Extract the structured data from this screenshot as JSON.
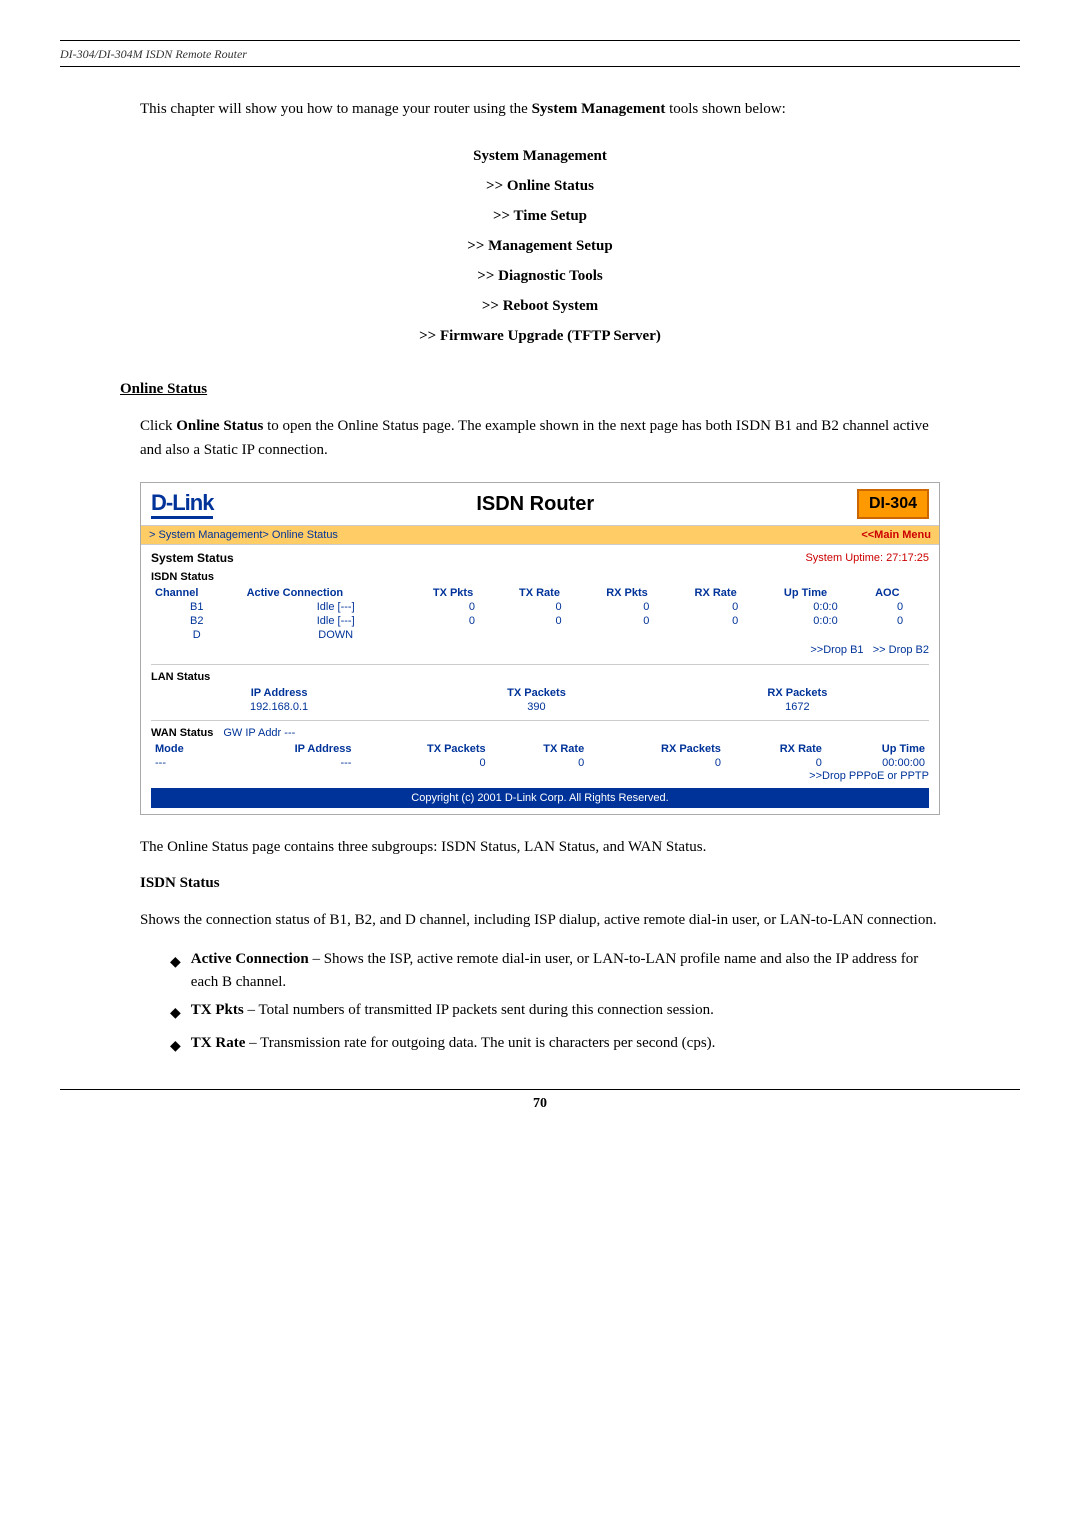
{
  "header": {
    "doc_title": "DI-304/DI-304M ISDN Remote Router"
  },
  "intro": {
    "text1": "This chapter will show you how to manage your router using the ",
    "bold1": "System Management",
    "text2": " tools shown below:"
  },
  "menu": {
    "title": "System Management",
    "items": [
      ">> Online Status",
      ">> Time Setup",
      ">> Management Setup",
      ">> Diagnostic Tools",
      ">> Reboot System",
      ">> Firmware Upgrade (TFTP Server)"
    ]
  },
  "online_status_heading": "Online Status",
  "online_status_intro": "Click ",
  "online_status_bold": "Online Status",
  "online_status_rest": " to open the Online Status page. The example shown in the next page has both ISDN B1 and B2 channel active and also a Static IP connection.",
  "router_ui": {
    "logo": "D-Link",
    "title": "ISDN Router",
    "badge": "DI-304",
    "nav_left": "> System Management> Online Status",
    "nav_right": "<<Main Menu",
    "system_status_label": "System Status",
    "system_uptime_label": "System Uptime:",
    "system_uptime_value": "27:17:25",
    "isdn_status_label": "ISDN Status",
    "isdn_columns": [
      "Channel",
      "Active Connection",
      "TX Pkts",
      "TX Rate",
      "RX Pkts",
      "RX Rate",
      "Up Time",
      "AOC"
    ],
    "isdn_rows": [
      {
        "channel": "B1",
        "active": "Idle [---]",
        "tx_pkts": "0",
        "tx_rate": "0",
        "rx_pkts": "0",
        "rx_rate": "0",
        "up_time": "0:0:0",
        "aoc": "0"
      },
      {
        "channel": "B2",
        "active": "Idle [---]",
        "tx_pkts": "0",
        "tx_rate": "0",
        "rx_pkts": "0",
        "rx_rate": "0",
        "up_time": "0:0:0",
        "aoc": "0"
      },
      {
        "channel": "D",
        "active": "DOWN",
        "tx_pkts": "",
        "tx_rate": "",
        "rx_pkts": "",
        "rx_rate": "",
        "up_time": "",
        "aoc": ""
      }
    ],
    "drop_b1": ">>Drop B1",
    "drop_b2": ">> Drop B2",
    "lan_status_label": "LAN Status",
    "lan_columns": [
      "IP Address",
      "TX Packets",
      "RX Packets"
    ],
    "lan_row": {
      "ip": "192.168.0.1",
      "tx": "390",
      "rx": "1672"
    },
    "wan_status_label": "WAN Status",
    "wan_gw_label": "GW IP Addr",
    "wan_gw_value": "---",
    "wan_columns": [
      "Mode",
      "IP Address",
      "TX Packets",
      "TX Rate",
      "RX Packets",
      "RX Rate",
      "Up Time"
    ],
    "wan_row": {
      "mode": "---",
      "ip": "---",
      "tx_pkts": "0",
      "tx_rate": "0",
      "rx_pkts": "0",
      "rx_rate": "0",
      "up_time": "00:00:00"
    },
    "drop_pppoe": ">>Drop PPPoE or PPTP",
    "copyright": "Copyright (c) 2001 D-Link Corp. All Rights Reserved."
  },
  "body_para1": "The Online Status page contains three subgroups: ISDN Status, LAN Status, and WAN Status.",
  "isdn_status_section_heading": "ISDN Status",
  "isdn_status_desc": "Shows the connection status of B1, B2, and D channel, including ISP dialup, active remote dial-in user, or LAN-to-LAN connection.",
  "bullets": [
    {
      "label": "Active Connection",
      "dash": " – ",
      "text": "Shows the ISP, active remote dial-in user, or LAN-to-LAN profile name and also the IP address for each B channel."
    },
    {
      "label": "TX Pkts",
      "dash": " – ",
      "text": "Total numbers of transmitted IP packets sent during this connection session."
    },
    {
      "label": "TX Rate",
      "dash": " – ",
      "text": "Transmission rate for outgoing data. The unit is characters per second (cps)."
    }
  ],
  "footer": {
    "page_number": "70"
  }
}
